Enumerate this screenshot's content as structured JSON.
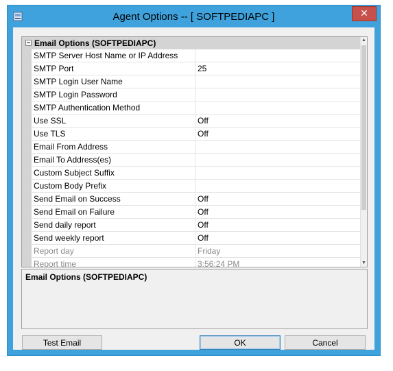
{
  "window": {
    "title": "Agent Options -- [ SOFTPEDIAPC ]",
    "close_glyph": "✕"
  },
  "grid": {
    "category": "Email Options (SOFTPEDIAPC)",
    "rows": [
      {
        "name": "SMTP Server Host Name or IP Address",
        "value": ""
      },
      {
        "name": "SMTP Port",
        "value": "25"
      },
      {
        "name": "SMTP Login User Name",
        "value": ""
      },
      {
        "name": "SMTP Login Password",
        "value": ""
      },
      {
        "name": "SMTP Authentication Method",
        "value": ""
      },
      {
        "name": "Use SSL",
        "value": "Off"
      },
      {
        "name": "Use TLS",
        "value": "Off"
      },
      {
        "name": "Email From Address",
        "value": ""
      },
      {
        "name": "Email To Address(es)",
        "value": ""
      },
      {
        "name": "Custom Subject Suffix",
        "value": ""
      },
      {
        "name": "Custom Body Prefix",
        "value": ""
      },
      {
        "name": "Send Email on Success",
        "value": "Off"
      },
      {
        "name": "Send Email on Failure",
        "value": "Off"
      },
      {
        "name": "Send daily report",
        "value": "Off"
      },
      {
        "name": "Send weekly report",
        "value": "Off"
      },
      {
        "name": "Report day",
        "value": "Friday"
      },
      {
        "name": "Report time",
        "value": "3:56:24 PM"
      }
    ]
  },
  "description": {
    "title": "Email Options (SOFTPEDIAPC)"
  },
  "buttons": {
    "test_email": "Test Email",
    "ok": "OK",
    "cancel": "Cancel"
  }
}
